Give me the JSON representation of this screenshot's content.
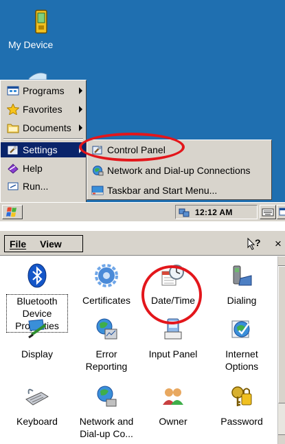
{
  "desktop": {
    "icon_label": "My Device",
    "background_color": "#1f6fb0"
  },
  "start_menu": {
    "items": [
      {
        "label": "Programs",
        "icon": "programs-icon",
        "submenu": true
      },
      {
        "label": "Favorites",
        "icon": "favorites-star-icon",
        "submenu": true
      },
      {
        "label": "Documents",
        "icon": "documents-folder-icon",
        "submenu": true
      },
      {
        "label": "Settings",
        "icon": "settings-icon",
        "submenu": true,
        "active": true
      },
      {
        "label": "Help",
        "icon": "help-icon",
        "submenu": false
      },
      {
        "label": "Run...",
        "icon": "run-icon",
        "submenu": false
      }
    ],
    "settings_submenu": [
      {
        "label": "Control Panel",
        "icon": "control-panel-icon"
      },
      {
        "label": "Network and Dial-up Connections",
        "icon": "network-globe-icon"
      },
      {
        "label": "Taskbar and Start Menu...",
        "icon": "taskbar-icon"
      }
    ]
  },
  "taskbar": {
    "clock": "12:12 AM",
    "start_icon": "windows-flag-icon"
  },
  "control_panel": {
    "menu": [
      "File",
      "View"
    ],
    "help_label": "?",
    "close_label": "×",
    "items": [
      {
        "label": "Bluetooth Device Properties",
        "icon": "bluetooth-icon"
      },
      {
        "label": "Certificates",
        "icon": "certificates-icon"
      },
      {
        "label": "Date/Time",
        "icon": "date-time-icon"
      },
      {
        "label": "Dialing",
        "icon": "dialing-phone-icon"
      },
      {
        "label": "Display",
        "icon": "display-icon"
      },
      {
        "label": "Error Reporting",
        "icon": "error-reporting-icon"
      },
      {
        "label": "Input Panel",
        "icon": "input-panel-icon"
      },
      {
        "label": "Internet Options",
        "icon": "internet-options-icon"
      },
      {
        "label": "Keyboard",
        "icon": "keyboard-icon"
      },
      {
        "label": "Network and Dial-up Co...",
        "icon": "network-icon"
      },
      {
        "label": "Owner",
        "icon": "owner-icon"
      },
      {
        "label": "Password",
        "icon": "password-icon"
      }
    ]
  },
  "highlight_color": "#e3161b"
}
